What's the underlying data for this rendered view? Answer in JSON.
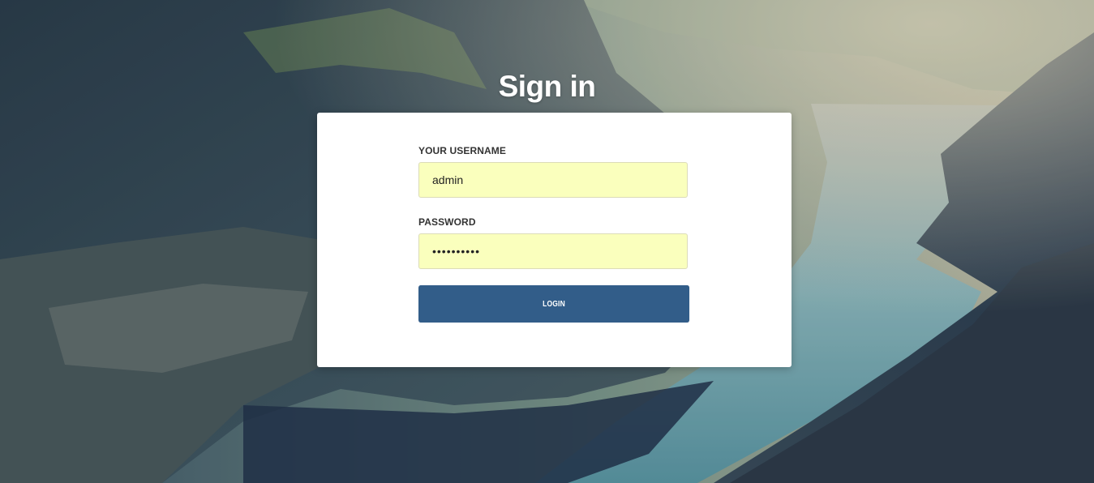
{
  "page": {
    "title": "Sign in",
    "background": "mountain-fjord-landscape"
  },
  "form": {
    "username_label": "YOUR USERNAME",
    "username_value": "admin",
    "password_label": "PASSWORD",
    "password_value": "••••••••••",
    "login_label": "LOGIN"
  },
  "colors": {
    "button": "#325d89",
    "autofill": "#faffbd",
    "card": "#ffffff"
  }
}
